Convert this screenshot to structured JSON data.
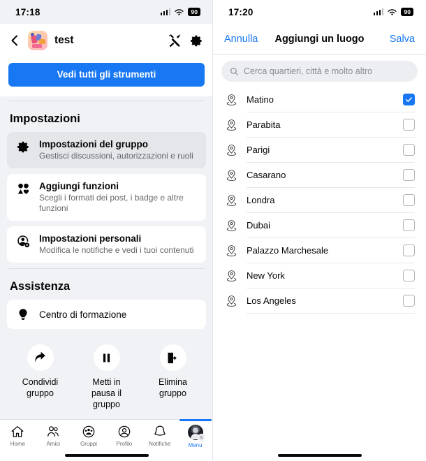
{
  "left": {
    "status": {
      "time": "17:18",
      "battery": "90",
      "signal_icon": "cellular-bars-icon",
      "wifi_icon": "wifi-icon"
    },
    "header": {
      "back_icon": "back-chevron-icon",
      "avatar_icon": "group-avatar",
      "title": "test",
      "tools_icon": "tools-icon",
      "settings_icon": "gear-icon"
    },
    "cta": {
      "label": "Vedi tutti gli strumenti",
      "color": "#1877f2"
    },
    "sections": [
      {
        "title": "Impostazioni",
        "items": [
          {
            "icon": "gear-icon",
            "title": "Impostazioni del gruppo",
            "subtitle": "Gestisci discussioni, autorizzazioni e ruoli",
            "selected": true
          },
          {
            "icon": "shapes-icon",
            "title": "Aggiungi funzioni",
            "subtitle": "Scegli i formati dei post, i badge e altre funzioni",
            "selected": false
          },
          {
            "icon": "person-gear-icon",
            "title": "Impostazioni personali",
            "subtitle": "Modifica le notifiche e vedi i tuoi contenuti",
            "selected": false
          }
        ]
      },
      {
        "title": "Assistenza",
        "items": [
          {
            "icon": "lightbulb-icon",
            "title": "Centro di formazione",
            "subtitle": "",
            "selected": false
          }
        ]
      }
    ],
    "actions": [
      {
        "icon": "share-arrow-icon",
        "label": "Condividi gruppo"
      },
      {
        "icon": "pause-icon",
        "label": "Metti in pausa il gruppo"
      },
      {
        "icon": "exit-door-icon",
        "label": "Elimina gruppo"
      }
    ],
    "tabbar": [
      {
        "icon": "home-icon",
        "label": "Home",
        "active": false
      },
      {
        "icon": "friends-icon",
        "label": "Amici",
        "active": false
      },
      {
        "icon": "groups-icon",
        "label": "Gruppi",
        "active": false
      },
      {
        "icon": "profile-icon",
        "label": "Profilo",
        "active": false
      },
      {
        "icon": "bell-icon",
        "label": "Notifiche",
        "active": false
      },
      {
        "icon": "menu-avatar-icon",
        "label": "Menu",
        "active": true
      }
    ]
  },
  "right": {
    "status": {
      "time": "17:20",
      "battery": "90",
      "signal_icon": "cellular-bars-icon",
      "wifi_icon": "wifi-icon"
    },
    "nav": {
      "cancel_label": "Annulla",
      "title": "Aggiungi un luogo",
      "save_label": "Salva",
      "accent": "#1877f2"
    },
    "search": {
      "icon": "search-icon",
      "placeholder": "Cerca quartieri, città e molto altro",
      "value": ""
    },
    "locations": [
      {
        "icon": "location-pin-icon",
        "name": "Matino",
        "checked": true
      },
      {
        "icon": "location-pin-icon",
        "name": "Parabita",
        "checked": false
      },
      {
        "icon": "location-pin-icon",
        "name": "Parigi",
        "checked": false
      },
      {
        "icon": "location-pin-icon",
        "name": "Casarano",
        "checked": false
      },
      {
        "icon": "location-pin-icon",
        "name": "Londra",
        "checked": false
      },
      {
        "icon": "location-pin-icon",
        "name": "Dubai",
        "checked": false
      },
      {
        "icon": "location-pin-icon",
        "name": "Palazzo Marchesale",
        "checked": false
      },
      {
        "icon": "location-pin-icon",
        "name": "New York",
        "checked": false
      },
      {
        "icon": "location-pin-icon",
        "name": "Los Angeles",
        "checked": false
      }
    ]
  }
}
